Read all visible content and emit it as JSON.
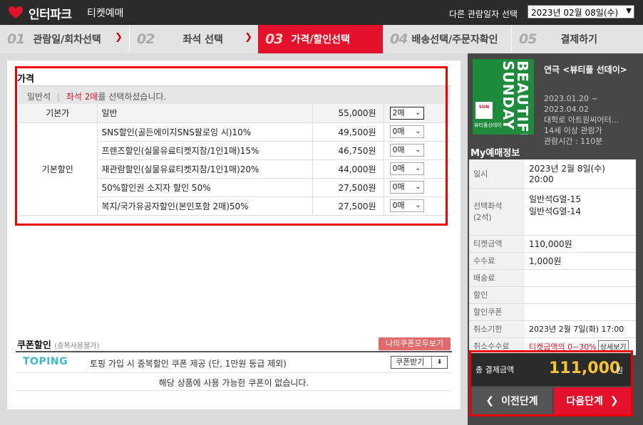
{
  "header": {
    "logo_text": "인터파크",
    "logo_sub": "티켓예매",
    "date_label": "다른 관람일자 선택",
    "date_value": "2023년 02월 08일(수)"
  },
  "steps": [
    {
      "num": "01",
      "label": "관람일/회차선택"
    },
    {
      "num": "02",
      "label": "좌석 선택"
    },
    {
      "num": "03",
      "label": "가격/할인선택"
    },
    {
      "num": "04",
      "label": "배송선택/주문자확인"
    },
    {
      "num": "05",
      "label": "결제하기"
    }
  ],
  "price": {
    "title": "가격",
    "seat_grade": "일반석",
    "selected_seats": "좌석 2매",
    "selected_suffix": "를 선택하셨습니다.",
    "base_label": "기본가",
    "discount_label": "기본할인",
    "rows": [
      {
        "name": "일반",
        "price": "55,000원",
        "qty": "2매"
      },
      {
        "name": "SNS할인(골든에이지SNS팔로잉 시)10%",
        "price": "49,500원",
        "qty": "0매"
      },
      {
        "name": "프렌즈할인(실물유료티켓지참/1인1매)15%",
        "price": "46,750원",
        "qty": "0매"
      },
      {
        "name": "재관람할인(실물유료티켓지참/1인1매)20%",
        "price": "44,000원",
        "qty": "0매"
      },
      {
        "name": "50%할인권 소지자 할인 50%",
        "price": "27,500원",
        "qty": "0매"
      },
      {
        "name": "복지/국가유공자할인(본인포함 2매)50%",
        "price": "27,500원",
        "qty": "0매"
      }
    ]
  },
  "coupon": {
    "title": "쿠폰할인",
    "title_note": "(중복사용불가)",
    "all_button": "나의쿠폰모두보기",
    "brand": "TOPING",
    "desc": "토핑 가입 시 중복할인 쿠폰 제공 (단, 1만원 등급 제외)",
    "get_button": "쿠폰받기",
    "empty": "해당 상품에 사용 가능한 쿠폰이 없습니다."
  },
  "show": {
    "poster_title": "BEAUTIFUL SUNDAY",
    "poster_badge": "SUN",
    "poster_caption": "뷰티풀선데이",
    "title": "연극 <뷰티풀 선데이>",
    "period_start": "2023.01.20 ~",
    "period_end": "2023.04.02",
    "venue": "대학로 아트원씨어터...",
    "age": "14세 이상 관람가",
    "runtime": "관람시간 : 110분"
  },
  "my_info": {
    "title": "My예매정보",
    "date_label": "일시",
    "date_value1": "2023년 2월 8일(수)",
    "date_value2": "20:00",
    "seat_label1": "선택좌석",
    "seat_label2": "(2석)",
    "seat1": "일반석G열-15",
    "seat2": "일반석G열-14",
    "ticket_label": "티켓금액",
    "ticket_value": "110,000원",
    "fee_label": "수수료",
    "fee_value": "1,000원",
    "delivery_label": "배송료",
    "discount_label": "할인",
    "coupon_label": "할인쿠폰",
    "cancel_deadline_label": "취소기한",
    "cancel_deadline_value": "2023년 2월 7일(화) 17:00",
    "cancel_fee_label": "취소수수료",
    "cancel_fee_value": "티켓금액의 0~30%",
    "detail_button": "상세보기"
  },
  "total": {
    "label": "총 결제금액",
    "value": "111,000",
    "unit": "원"
  },
  "nav": {
    "prev": "이전단계",
    "next": "다음단계"
  },
  "colors": {
    "accent": "#e3122a",
    "total": "#f5c23a",
    "highlight": "#ee0000"
  }
}
